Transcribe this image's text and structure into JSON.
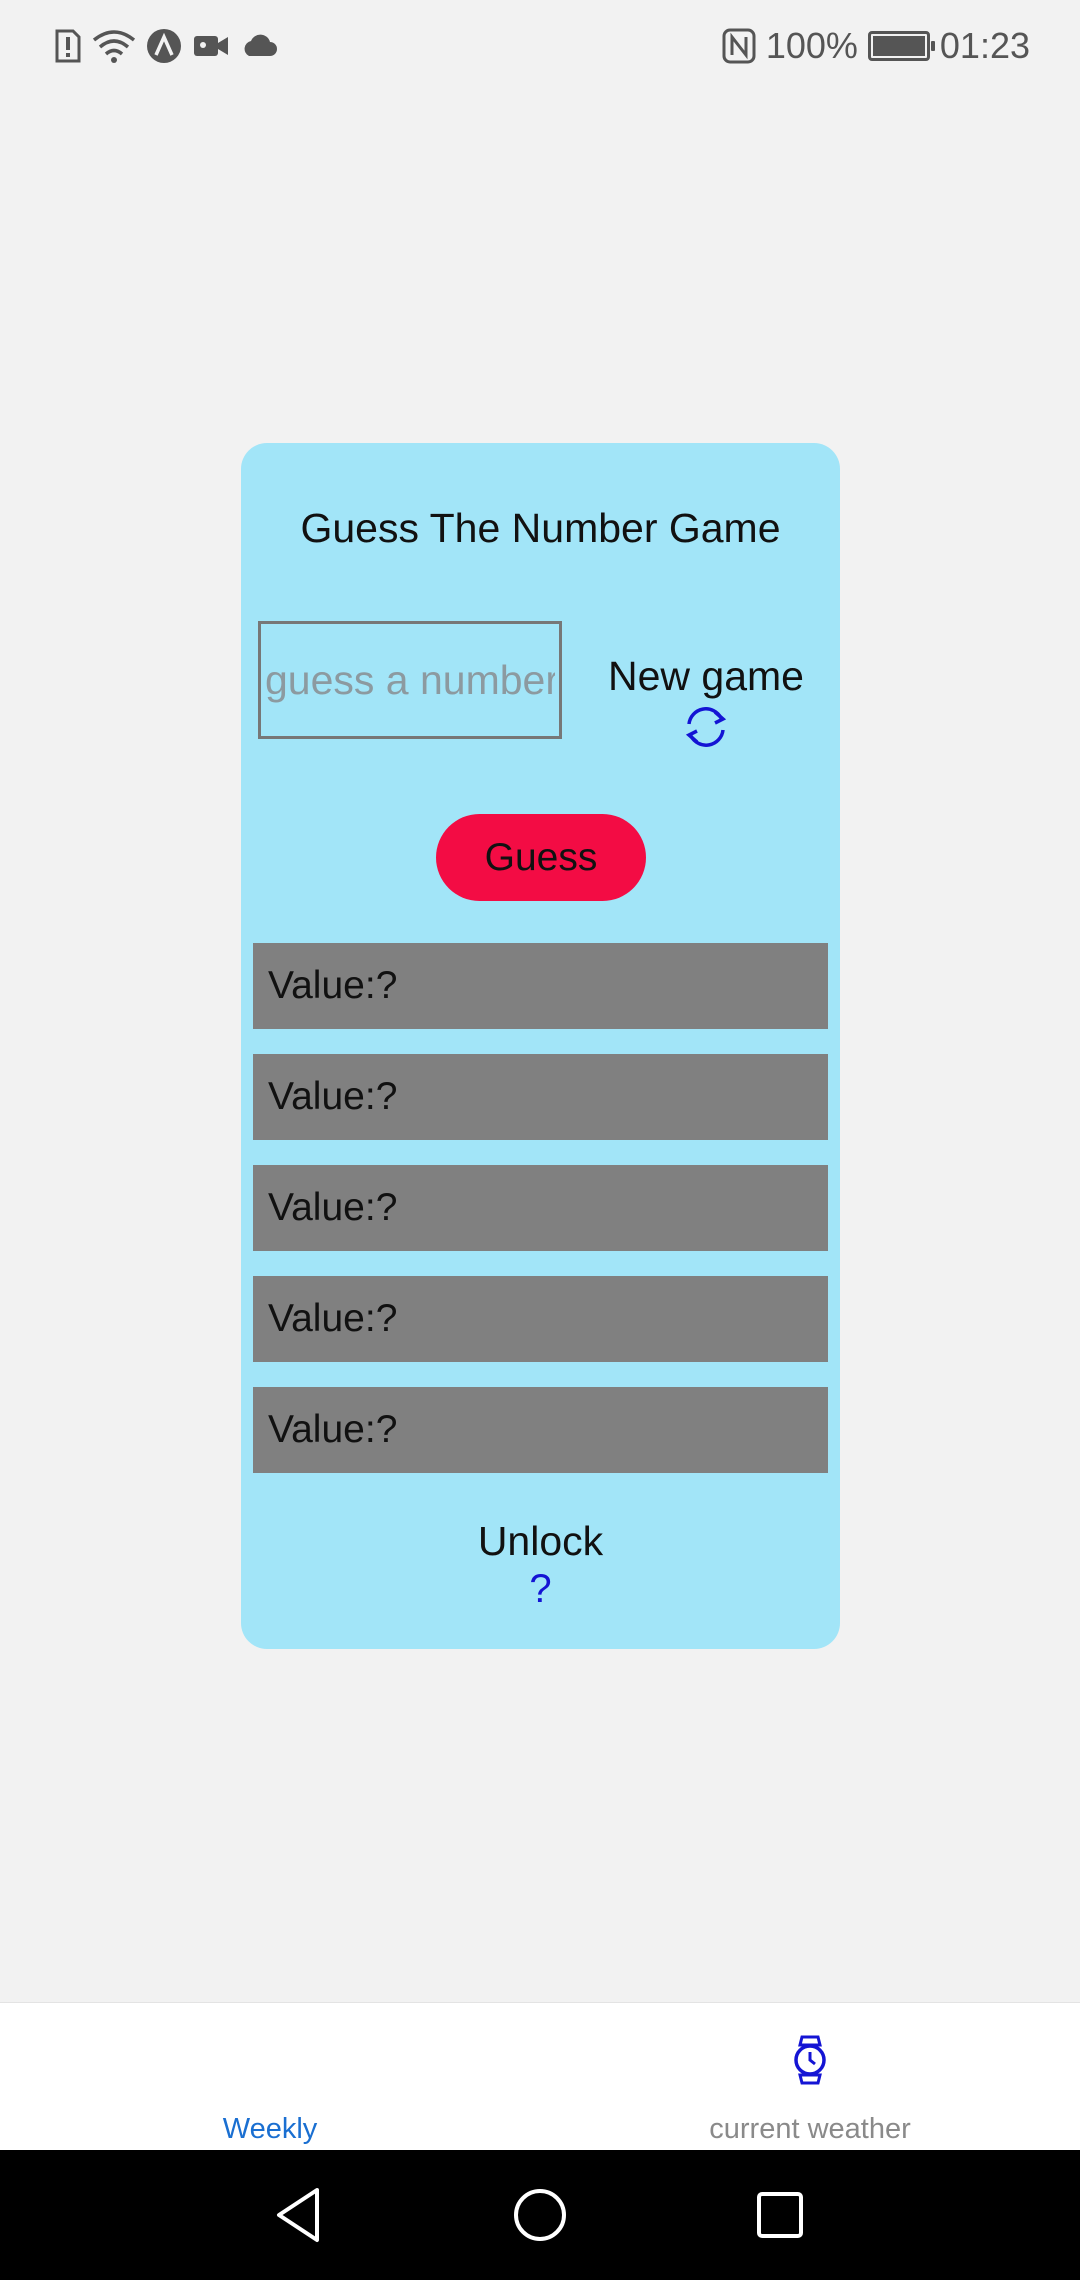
{
  "status_bar": {
    "battery_percent": "100%",
    "battery_level": 1.0,
    "time": "01:23",
    "left_icons": [
      "sim-alert-icon",
      "wifi-icon",
      "app-a-icon",
      "video-icon",
      "cloud-icon"
    ],
    "right_icons": [
      "nfc-icon",
      "battery-icon"
    ]
  },
  "game": {
    "title": "Guess The Number Game",
    "input_placeholder": "guess a number",
    "input_value": "",
    "new_game_label": "New game",
    "guess_button_label": "Guess",
    "values": [
      {
        "label": "Value:?"
      },
      {
        "label": "Value:?"
      },
      {
        "label": "Value:?"
      },
      {
        "label": "Value:?"
      },
      {
        "label": "Value:?"
      }
    ],
    "unlock_label": "Unlock",
    "unlock_hint": "?",
    "colors": {
      "card_bg": "#a2e5f8",
      "guess_button": "#f30c44",
      "value_row": "#808080",
      "accent_blue": "#1414d4"
    }
  },
  "tab_bar": {
    "tabs": [
      {
        "label": "Weekly",
        "active": true
      },
      {
        "label": "current weather",
        "active": false,
        "icon": "watch-icon"
      }
    ],
    "active_color": "#1a6fd1",
    "inactive_color": "#8a8a8a"
  },
  "nav_bar": {
    "buttons": [
      "back-icon",
      "home-icon",
      "recents-icon"
    ]
  }
}
